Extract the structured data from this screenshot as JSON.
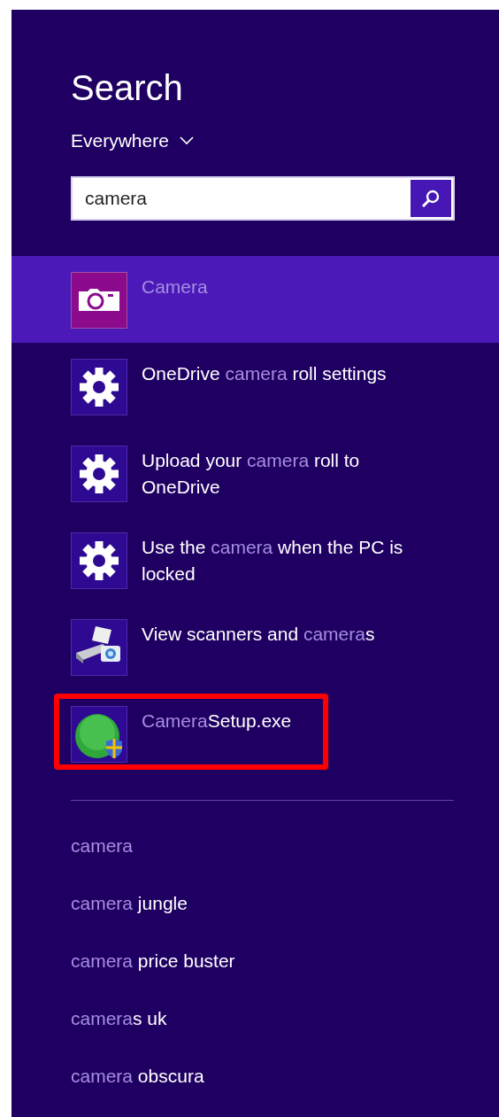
{
  "title": "Search",
  "scope": {
    "label": "Everywhere"
  },
  "search": {
    "value": "camera"
  },
  "results": [
    {
      "kind": "camera",
      "selected": true,
      "highlighted": false,
      "parts": [
        {
          "text": "Camera",
          "match": true
        }
      ]
    },
    {
      "kind": "gear",
      "selected": false,
      "highlighted": false,
      "parts": [
        {
          "text": "OneDrive ",
          "match": false
        },
        {
          "text": "camera",
          "match": true
        },
        {
          "text": " roll settings",
          "match": false
        }
      ]
    },
    {
      "kind": "gear",
      "selected": false,
      "highlighted": false,
      "parts": [
        {
          "text": "Upload your ",
          "match": false
        },
        {
          "text": "camera",
          "match": true
        },
        {
          "text": " roll to OneDrive",
          "match": false
        }
      ]
    },
    {
      "kind": "gear",
      "selected": false,
      "highlighted": false,
      "parts": [
        {
          "text": "Use the ",
          "match": false
        },
        {
          "text": "camera",
          "match": true
        },
        {
          "text": " when the PC is locked",
          "match": false
        }
      ]
    },
    {
      "kind": "scanner",
      "selected": false,
      "highlighted": false,
      "parts": [
        {
          "text": "View scanners and ",
          "match": false
        },
        {
          "text": "camera",
          "match": true
        },
        {
          "text": "s",
          "match": false
        }
      ]
    },
    {
      "kind": "setup",
      "selected": false,
      "highlighted": true,
      "parts": [
        {
          "text": "Camera",
          "match": true
        },
        {
          "text": "Setup.exe",
          "match": false
        }
      ]
    }
  ],
  "suggestions": [
    {
      "parts": [
        {
          "text": "camera",
          "match": true
        }
      ]
    },
    {
      "parts": [
        {
          "text": "camera",
          "match": true
        },
        {
          "text": " jungle",
          "match": false
        }
      ]
    },
    {
      "parts": [
        {
          "text": "camera",
          "match": true
        },
        {
          "text": " price buster",
          "match": false
        }
      ]
    },
    {
      "parts": [
        {
          "text": "camera",
          "match": true
        },
        {
          "text": "s uk",
          "match": false
        }
      ]
    },
    {
      "parts": [
        {
          "text": "camera",
          "match": true
        },
        {
          "text": " obscura",
          "match": false
        }
      ]
    }
  ]
}
